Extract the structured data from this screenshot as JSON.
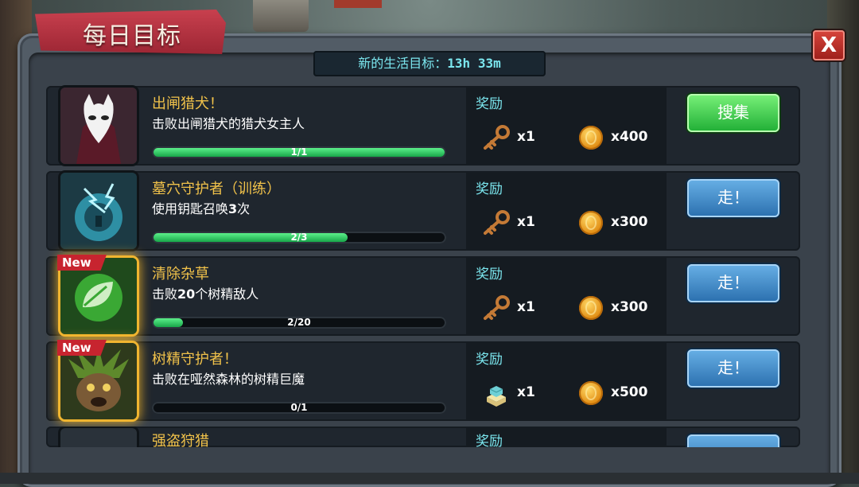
{
  "title": "每日目标",
  "close_label": "X",
  "timer": {
    "label": "新的生活目标：",
    "value": "13h 33m"
  },
  "reward_label": "奖励",
  "quests": [
    {
      "name": "出闸猎犬！",
      "description": "击败出闸猎犬的猎犬女主人",
      "progress_text": "1/1",
      "progress_current": 1,
      "progress_total": 1,
      "is_new": false,
      "reward_item": {
        "icon": "key-icon",
        "qty": "x1"
      },
      "reward_coin": {
        "icon": "coin-icon",
        "qty": "x400"
      },
      "button": {
        "label": "搜集",
        "style": "green"
      }
    },
    {
      "name": "墓穴守护者（训练）",
      "description_prefix": "使用钥匙召唤",
      "description_bold": "3",
      "description_suffix": "次",
      "progress_text": "2/3",
      "progress_current": 2,
      "progress_total": 3,
      "is_new": false,
      "reward_item": {
        "icon": "key-icon",
        "qty": "x1"
      },
      "reward_coin": {
        "icon": "coin-icon",
        "qty": "x300"
      },
      "button": {
        "label": "走！",
        "style": "blue"
      }
    },
    {
      "name": "清除杂草",
      "description_prefix": "击败",
      "description_bold": "20",
      "description_suffix": "个树精敌人",
      "progress_text": "2/20",
      "progress_current": 2,
      "progress_total": 20,
      "is_new": true,
      "new_label": "New",
      "reward_item": {
        "icon": "key-icon",
        "qty": "x1"
      },
      "reward_coin": {
        "icon": "coin-icon",
        "qty": "x300"
      },
      "button": {
        "label": "走！",
        "style": "blue"
      }
    },
    {
      "name": "树精守护者！",
      "description": "击败在哑然森林的树精巨魔",
      "progress_text": "0/1",
      "progress_current": 0,
      "progress_total": 1,
      "is_new": true,
      "new_label": "New",
      "reward_item": {
        "icon": "cake-icon",
        "qty": "x1"
      },
      "reward_coin": {
        "icon": "coin-icon",
        "qty": "x500"
      },
      "button": {
        "label": "走！",
        "style": "blue"
      }
    },
    {
      "name": "强盗狩猎",
      "reward_label_partial": "奖励"
    }
  ]
}
